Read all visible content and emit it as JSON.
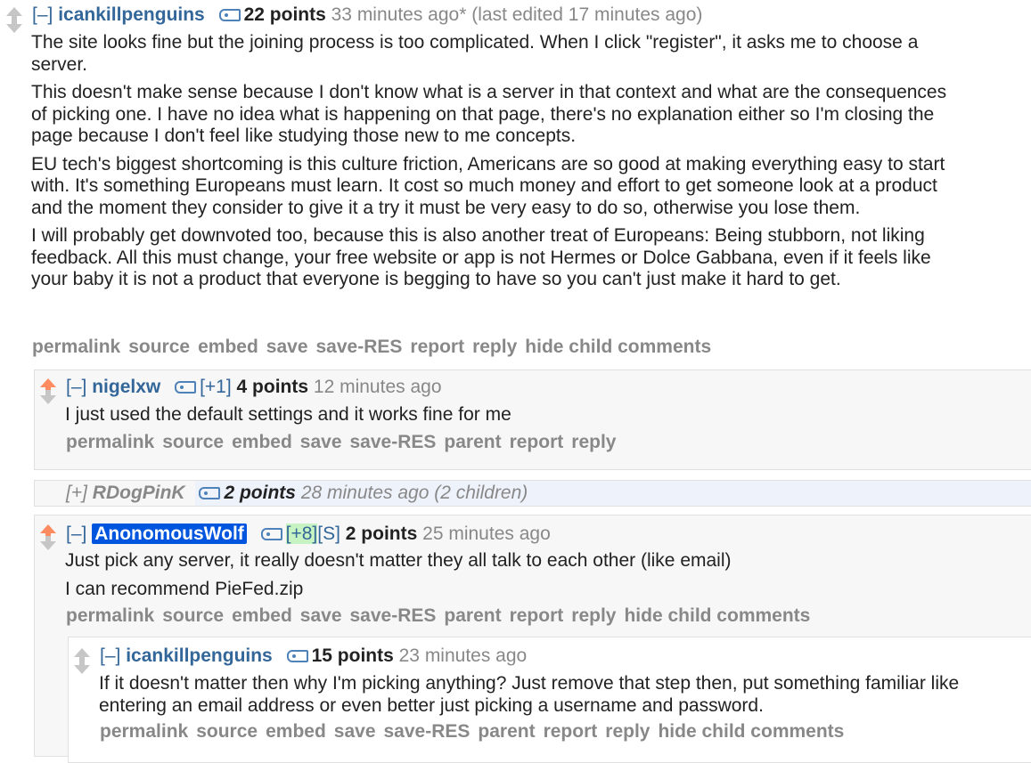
{
  "comments": [
    {
      "toggle": "[–]",
      "author": "icankillpenguins",
      "score": "22 points",
      "time": "33 minutes ago* (last edited 17 minutes ago)",
      "paragraphs": [
        "The site looks fine but the joining process is too complicated. When I click \"register\", it asks me to choose a server.",
        "This doesn't make sense because I don't know what is a server in that context and what are the consequences of picking one. I have no idea what is happening on that page, there's no explanation either so I'm closing the page because I don't feel like studying those new to me concepts.",
        "EU tech's biggest shortcoming is this culture friction, Americans are so good at making everything easy to start with. It's something Europeans must learn. It cost so much money and effort to get someone look at a product and the moment they consider to give it a try it must be very easy to do so, otherwise you lose them.",
        "I will probably get downvoted too, because this is also another treat of Europeans: Being stubborn, not liking feedback. All this must change, your free website or app is not Hermes or Dolce Gabbana, even if it feels like your baby it is not a product that everyone is begging to have so you can't just make it hard to get."
      ],
      "buttons": [
        "permalink",
        "source",
        "embed",
        "save",
        "save-RES",
        "report",
        "reply",
        "hide child comments"
      ]
    },
    {
      "toggle": "[–]",
      "author": "nigelxw",
      "vote_tag": "[+1]",
      "score": "4 points",
      "time": "12 minutes ago",
      "paragraphs": [
        "I just used the default settings and it works fine for me"
      ],
      "buttons": [
        "permalink",
        "source",
        "embed",
        "save",
        "save-RES",
        "parent",
        "report",
        "reply"
      ]
    },
    {
      "toggle": "[+]",
      "author": "RDogPinK",
      "score": "2 points",
      "time": "28 minutes ago (2 children)"
    },
    {
      "toggle": "[–]",
      "author": "AnonomousWolf",
      "vote_tag": "[+8]",
      "submitter_tag": "[S]",
      "score": "2 points",
      "time": "25 minutes ago",
      "paragraphs": [
        "Just pick any server, it really doesn't matter they all talk to each other (like email)",
        "I can recommend PieFed.zip"
      ],
      "buttons": [
        "permalink",
        "source",
        "embed",
        "save",
        "save-RES",
        "parent",
        "report",
        "reply",
        "hide child comments"
      ]
    },
    {
      "toggle": "[–]",
      "author": "icankillpenguins",
      "score": "15 points",
      "time": "23 minutes ago",
      "paragraphs": [
        "If it doesn't matter then why I'm picking anything? Just remove that step then, put something familiar like entering an email address or even better just picking a username and password."
      ],
      "buttons": [
        "permalink",
        "source",
        "embed",
        "save",
        "save-RES",
        "parent",
        "report",
        "reply",
        "hide child comments"
      ]
    }
  ],
  "colors": {
    "link": "#336699",
    "upvoted": "#ff8b60",
    "op_highlight": "#0055df",
    "positive_tag": "#c7f3c3"
  }
}
